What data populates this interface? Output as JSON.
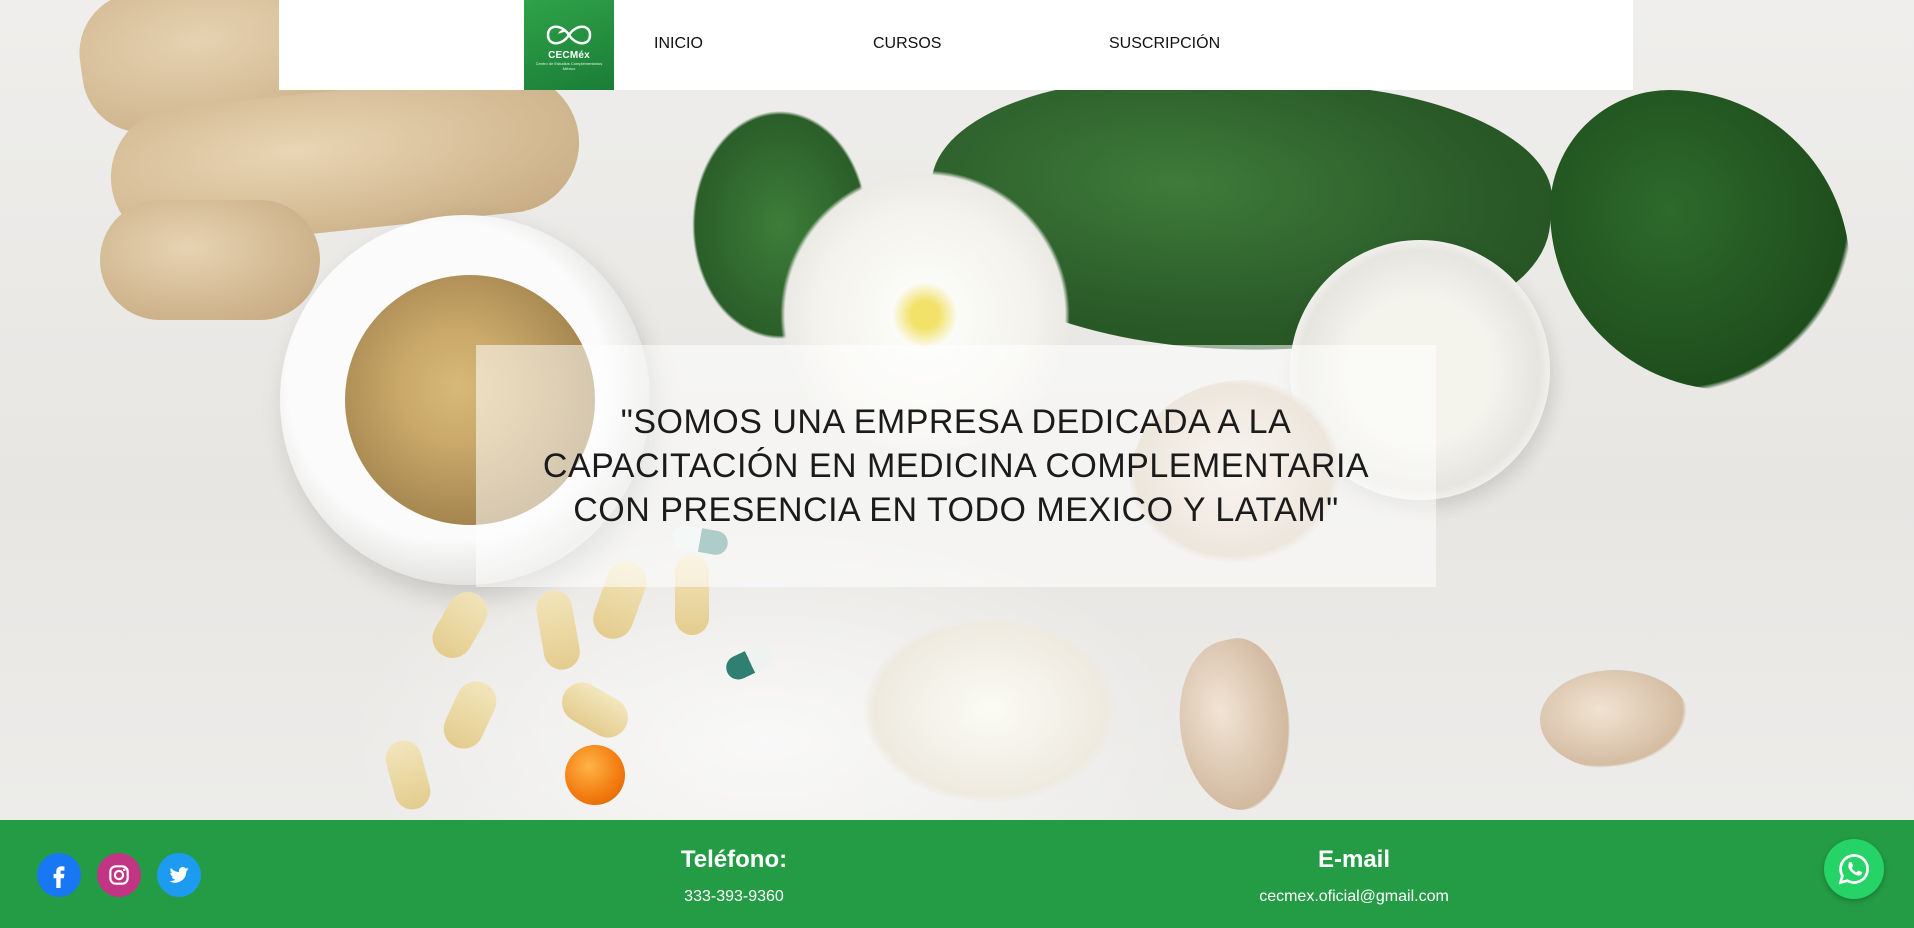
{
  "logo": {
    "name": "CECMéx",
    "subtitle": "Centro de Estudios Complementarios México"
  },
  "nav": {
    "items": [
      {
        "label": "INICIO"
      },
      {
        "label": "CURSOS"
      },
      {
        "label": "SUSCRIPCIÓN"
      }
    ]
  },
  "hero": {
    "quote": "\"SOMOS UNA EMPRESA DEDICADA A LA CAPACITACIÓN EN MEDICINA COMPLEMENTARIA CON PRESENCIA EN TODO MEXICO Y LATAM\""
  },
  "footer": {
    "social": [
      {
        "name": "facebook-icon",
        "color": "#1877f2"
      },
      {
        "name": "instagram-icon",
        "color": "#c13584"
      },
      {
        "name": "twitter-icon",
        "color": "#1d9bf0"
      }
    ],
    "phone_heading": "Teléfono:",
    "phone_value": "333-393-9360",
    "email_heading": "E-mail",
    "email_value": "cecmex.oficial@gmail.com",
    "whatsapp_icon": "whatsapp-icon"
  },
  "colors": {
    "brand_green": "#249c45",
    "whatsapp_green": "#25d366"
  }
}
